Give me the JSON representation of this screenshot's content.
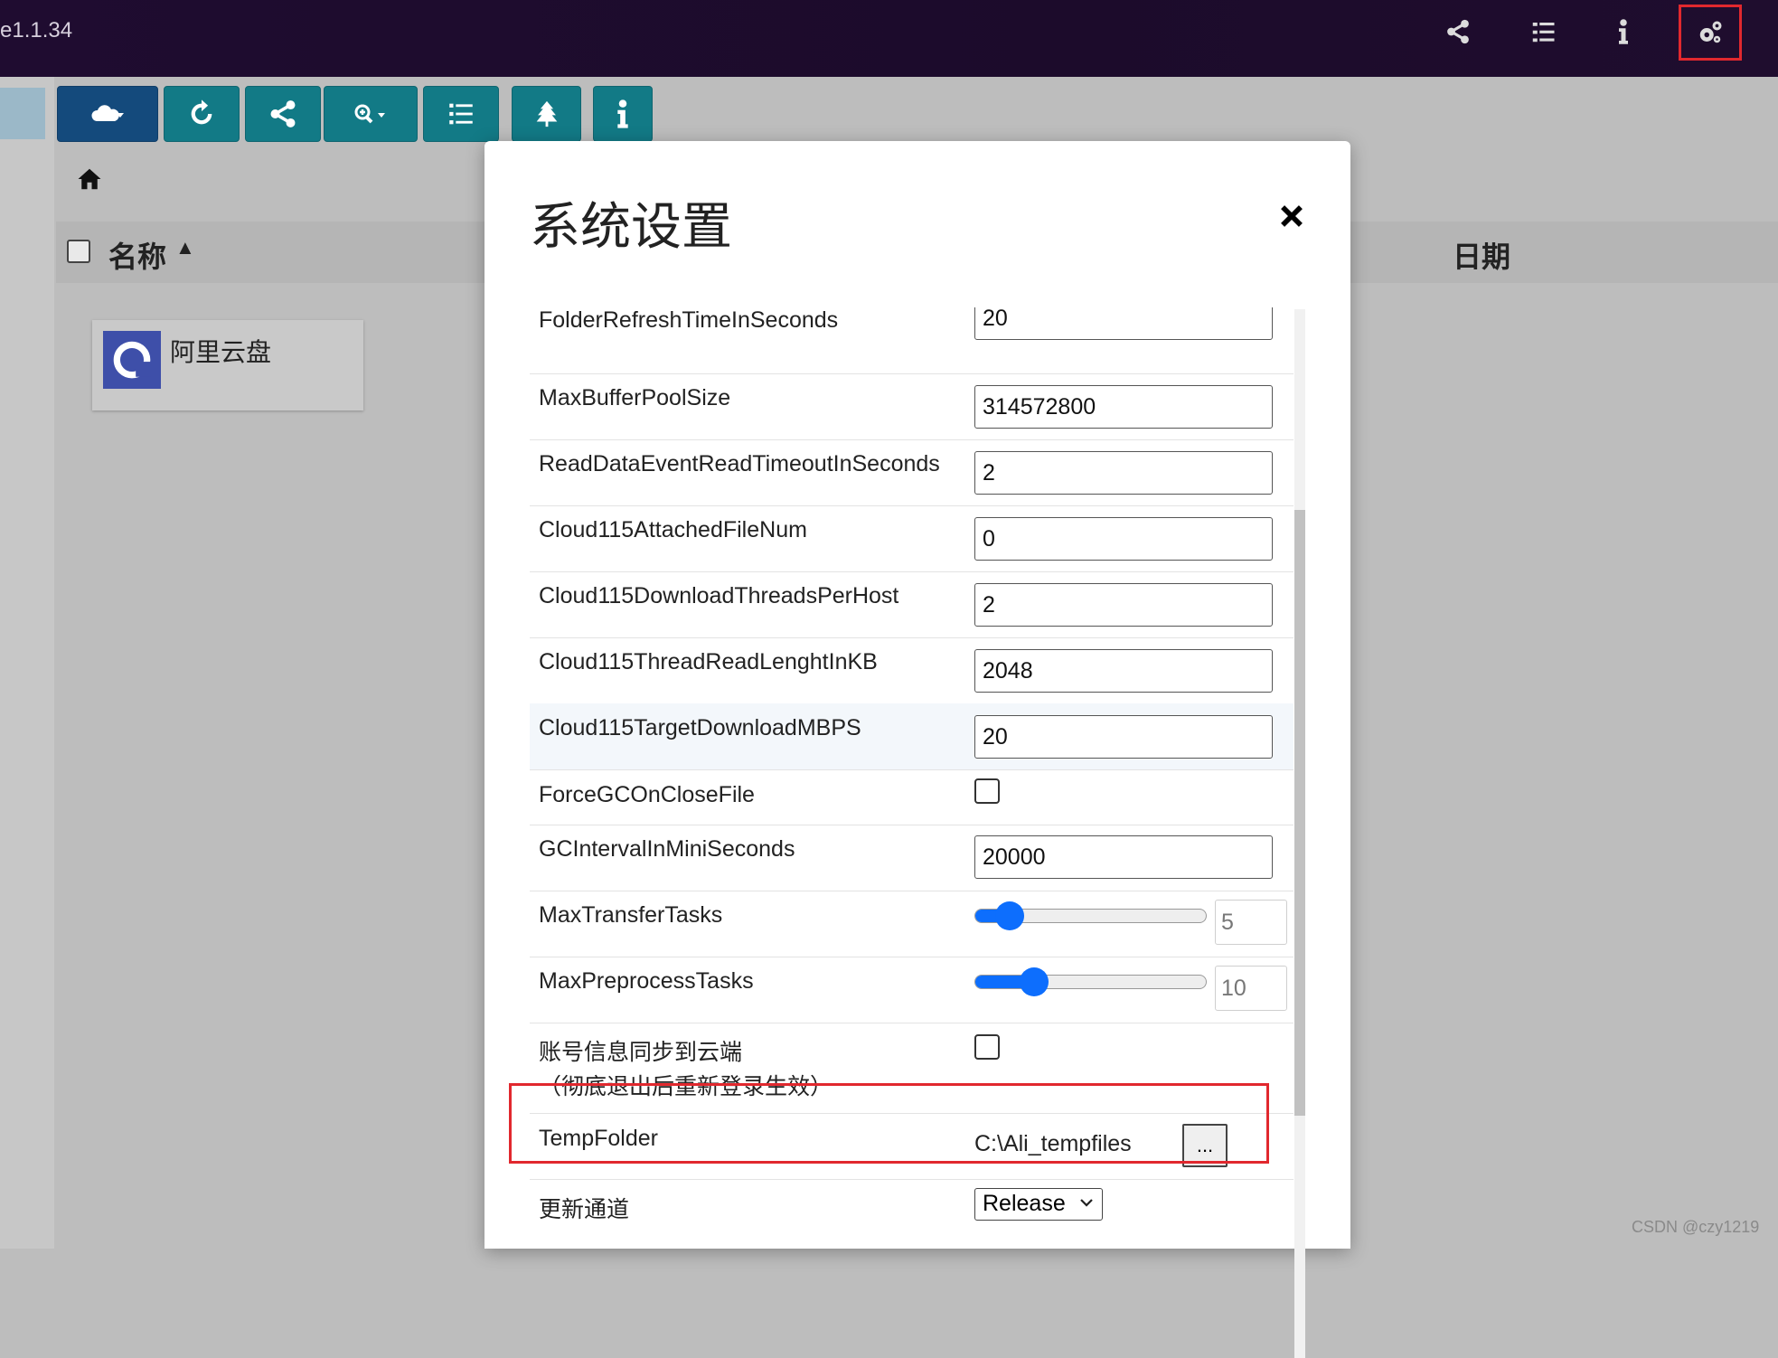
{
  "app": {
    "version": "e1.1.34"
  },
  "topbar": {
    "icons": [
      "share-icon",
      "task-list-icon",
      "info-icon",
      "settings-gears-icon"
    ]
  },
  "toolbar": {
    "buttons": [
      "cloud-dropdown-icon",
      "refresh-icon",
      "share-icon",
      "zoom-dropdown-icon",
      "list-view-icon",
      "tree-icon",
      "info-icon"
    ]
  },
  "file_list": {
    "header_name": "名称",
    "header_date": "日期",
    "items": [
      {
        "label": "阿里云盘",
        "icon": "aliyun-drive-icon"
      }
    ]
  },
  "modal": {
    "title": "系统设置",
    "settings": [
      {
        "key": "FolderRefreshTimeInSeconds",
        "value": "20"
      },
      {
        "key": "MaxBufferPoolSize",
        "value": "314572800"
      },
      {
        "key": "ReadDataEventReadTimeoutInSeconds",
        "value": "2"
      },
      {
        "key": "Cloud115AttachedFileNum",
        "value": "0"
      },
      {
        "key": "Cloud115DownloadThreadsPerHost",
        "value": "2"
      },
      {
        "key": "Cloud115ThreadReadLenghtInKB",
        "value": "2048"
      },
      {
        "key": "Cloud115TargetDownloadMBPS",
        "value": "20"
      },
      {
        "key": "ForceGCOnCloseFile",
        "checked": false
      },
      {
        "key": "GCIntervalInMiniSeconds",
        "value": "20000"
      },
      {
        "key": "MaxTransferTasks",
        "value": "5",
        "slider_fraction": 0.1
      },
      {
        "key": "MaxPreprocessTasks",
        "value": "10",
        "slider_fraction": 0.22
      },
      {
        "key": "账号信息同步到云端",
        "key_line2": "（彻底退出后重新登录生效）",
        "checked": false
      },
      {
        "key": "TempFolder",
        "value": "C:\\Ali_tempfiles",
        "browse_label": "..."
      },
      {
        "key": "更新通道",
        "value": "Release"
      }
    ]
  },
  "watermark": "CSDN @czy1219",
  "colors": {
    "annotation": "#e1282e",
    "accent": "#0d6efd",
    "toolbar": "#127a86"
  }
}
